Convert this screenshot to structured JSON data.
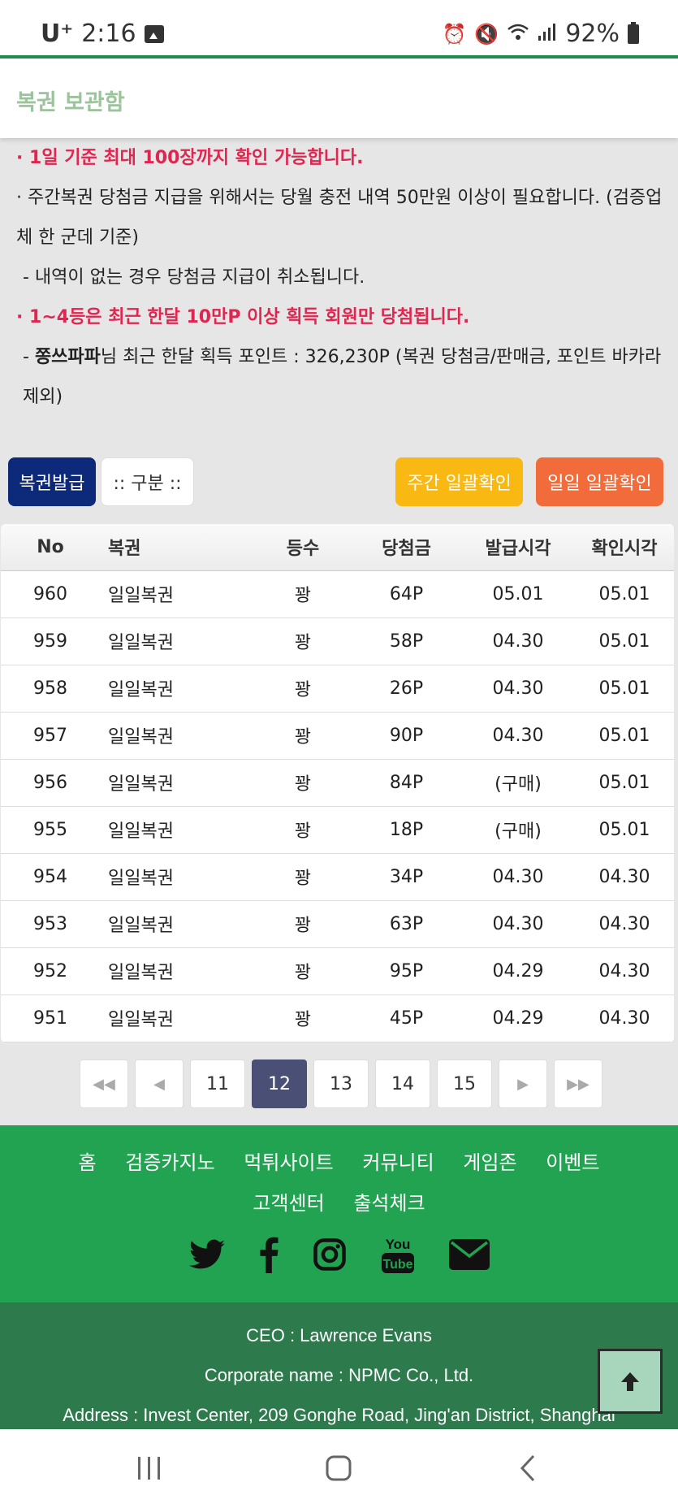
{
  "status_bar": {
    "carrier": "U⁺",
    "time": "2:16",
    "battery": "92%"
  },
  "header": {
    "title": "복권 보관함"
  },
  "notices": {
    "line1": "· 1일 기준 최대 100장까지 확인 가능합니다.",
    "line2": "· 주간복권 당첨금 지급을 위해서는 당월 충전 내역 50만원 이상이 필요합니다. (검증업체 한 군데 기준)",
    "line3": "- 내역이 없는 경우 당첨금 지급이 취소됩니다.",
    "line4": "· 1~4등은 최근 한달 10만P 이상 획득 회원만 당첨됩니다.",
    "line5_user": "쫑쓰파파",
    "line5_rest": "님 최근 한달 획득 포인트 : 326,230P (복권 당첨금/판매금, 포인트 바카라 제외)",
    "line5_prefix": "- "
  },
  "buttons": {
    "issue": "복권발급",
    "category": ":: 구분 ::",
    "weekly": "주간 일괄확인",
    "daily": "일일 일괄확인"
  },
  "table": {
    "headers": [
      "No",
      "복권",
      "등수",
      "당첨금",
      "발급시각",
      "확인시각"
    ],
    "rows": [
      [
        "960",
        "일일복권",
        "꽝",
        "64P",
        "05.01",
        "05.01"
      ],
      [
        "959",
        "일일복권",
        "꽝",
        "58P",
        "04.30",
        "05.01"
      ],
      [
        "958",
        "일일복권",
        "꽝",
        "26P",
        "04.30",
        "05.01"
      ],
      [
        "957",
        "일일복권",
        "꽝",
        "90P",
        "04.30",
        "05.01"
      ],
      [
        "956",
        "일일복권",
        "꽝",
        "84P",
        "(구매)",
        "05.01"
      ],
      [
        "955",
        "일일복권",
        "꽝",
        "18P",
        "(구매)",
        "05.01"
      ],
      [
        "954",
        "일일복권",
        "꽝",
        "34P",
        "04.30",
        "04.30"
      ],
      [
        "953",
        "일일복권",
        "꽝",
        "63P",
        "04.30",
        "04.30"
      ],
      [
        "952",
        "일일복권",
        "꽝",
        "95P",
        "04.29",
        "04.30"
      ],
      [
        "951",
        "일일복권",
        "꽝",
        "45P",
        "04.29",
        "04.30"
      ]
    ]
  },
  "pagination": {
    "pages": [
      "11",
      "12",
      "13",
      "14",
      "15"
    ],
    "current": "12"
  },
  "footer_nav": {
    "row1": [
      "홈",
      "검증카지노",
      "먹튀사이트",
      "커뮤니티",
      "게임존",
      "이벤트"
    ],
    "row2": [
      "고객센터",
      "출석체크"
    ],
    "social_icons": [
      "twitter-icon",
      "facebook-icon",
      "instagram-icon",
      "youtube-icon",
      "email-icon"
    ],
    "youtube_text_top": "You",
    "youtube_text_bottom": "Tube"
  },
  "company": {
    "ceo": "CEO : Lawrence Evans",
    "name": "Corporate name : NPMC Co., Ltd.",
    "address": "Address : Invest Center, 209 Gonghe Road, Jing'an District, Shanghai"
  },
  "colors": {
    "brand_green": "#22a352",
    "dark_green": "#2d7a4c",
    "accent_red": "#e02650",
    "navy": "#0d2a7a"
  }
}
